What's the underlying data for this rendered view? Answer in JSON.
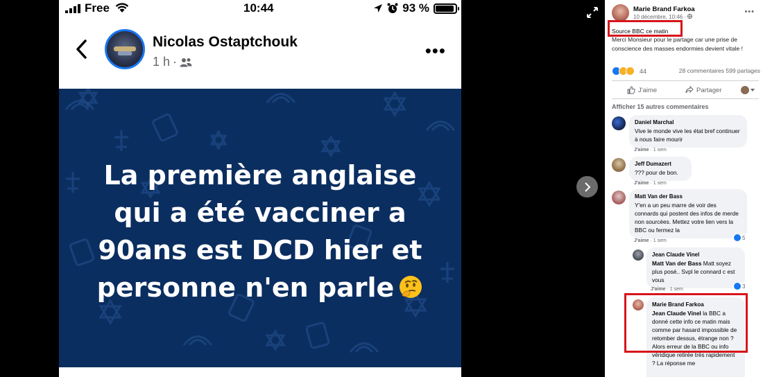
{
  "phone": {
    "status": {
      "carrier": "Free",
      "time": "10:44",
      "battery": "93 %",
      "battery_level": 0.93
    },
    "post": {
      "author": "Nicolas Ostaptchouk",
      "time": "1 h",
      "meta_separator": "·",
      "more": "•••",
      "image_text_lines": [
        "La première anglaise",
        "qui a été vacciner a",
        "90ans est DCD hier et",
        "personne n'en parle"
      ],
      "image_bg_color": "#0b2e60"
    }
  },
  "panel": {
    "post": {
      "author": "Marie Brand Farkoa",
      "date": "10 décembre, 10:46 ·",
      "more": "•••",
      "text_line1": "Source BBC ce matin",
      "text_line2": "Merci Monsieur pour le partage car une prise de conscience des masses endormies devient vitale !",
      "reactions_count": "44",
      "comments_count": "28 commentaires",
      "shares_count": "599 partages"
    },
    "actions": {
      "like": "J'aime",
      "share": "Partager"
    },
    "more_comments": "Afficher 15 autres commentaires",
    "comments": [
      {
        "name": "Daniel Marchal",
        "text": "Vive le monde vive les état bref continuer à nous faire mourir",
        "like": "J'aime",
        "age": "· 1 sem"
      },
      {
        "name": "Jeff Dumazert",
        "text": "??? pour de bon.",
        "like": "J'aime",
        "age": "· 1 sem"
      },
      {
        "name": "Matt Van der Bass",
        "text": "Y'en a un peu marre de voir des connards qui postent des infos de merde non sourcées. Mettez votre lien vers la BBC ou fermez la",
        "like": "J'aime",
        "age": "· 1 sem",
        "reactions": "5"
      },
      {
        "name": "Jean Claude Vinel",
        "mention": "Matt Van der Bass",
        "text": "Matt soyez plus posé.. Svpl le connard c est vous",
        "like": "J'aime",
        "age": "· 1 sem",
        "reactions": "3"
      },
      {
        "name": "Marie Brand Farkoa",
        "mention": "Jean Claude Vinel",
        "text": "la BBC a donné cette info ce matin mais comme par hasard impossible de retomber dessus, étrange non ? Alors erreur de la BBC ou info véridique retirée très rapidement ? La réponse me"
      }
    ],
    "highlight_color": "#d7141a",
    "accent_color": "#1877f2"
  }
}
